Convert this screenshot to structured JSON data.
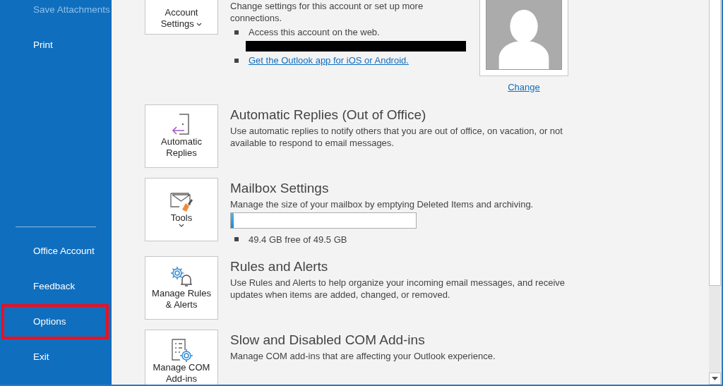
{
  "sidebar": {
    "items": [
      {
        "label": "Save Attachments",
        "disabled": true,
        "highlighted": false
      },
      {
        "label": "Print",
        "disabled": false,
        "highlighted": false
      }
    ],
    "footer_items": [
      {
        "label": "Office Account",
        "highlighted": false
      },
      {
        "label": "Feedback",
        "highlighted": false
      },
      {
        "label": "Options",
        "highlighted": true
      },
      {
        "label": "Exit",
        "highlighted": false
      }
    ]
  },
  "account": {
    "button_label": "Account Settings",
    "description": "Change settings for this account or set up more connections.",
    "bullets": [
      {
        "kind": "text",
        "text": "Access this account on the web."
      },
      {
        "kind": "redacted"
      },
      {
        "kind": "link",
        "text": "Get the Outlook app for iOS or Android."
      }
    ],
    "photo": {
      "change_link": "Change"
    }
  },
  "sections": [
    {
      "kind": "auto-replies",
      "button_label": "Automatic Replies",
      "title": "Automatic Replies (Out of Office)",
      "description": "Use automatic replies to notify others that you are out of office, on vacation, or not available to respond to email messages."
    },
    {
      "kind": "mailbox",
      "button_label": "Tools",
      "title": "Mailbox Settings",
      "description": "Manage the size of your mailbox by emptying Deleted Items and archiving.",
      "storage": {
        "level": 0.015,
        "reading": "49.4 GB free of 49.5 GB"
      }
    },
    {
      "kind": "rules",
      "button_label": "Manage Rules & Alerts",
      "title": "Rules and Alerts",
      "description": "Use Rules and Alerts to help organize your incoming email messages, and receive updates when items are added, changed, or removed."
    },
    {
      "kind": "com-addins",
      "button_label": "Manage COM Add-ins",
      "title": "Slow and Disabled COM Add-ins",
      "description": "Manage COM add-ins that are affecting your Outlook experience."
    }
  ]
}
